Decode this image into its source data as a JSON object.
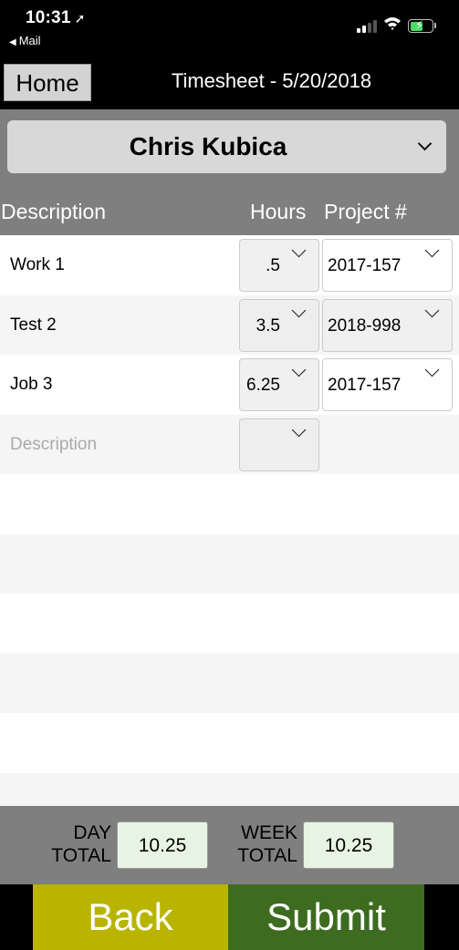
{
  "status": {
    "time": "10:31",
    "back_app": "Mail"
  },
  "nav": {
    "home_label": "Home",
    "title": "Timesheet - 5/20/2018"
  },
  "employee": {
    "name": "Chris Kubica"
  },
  "columns": {
    "description": "Description",
    "hours": "Hours",
    "project": "Project #"
  },
  "entries": [
    {
      "description": "Work 1",
      "hours": ".5",
      "project": "2017-157"
    },
    {
      "description": "Test 2",
      "hours": "3.5",
      "project": "2018-998"
    },
    {
      "description": "Job 3",
      "hours": "6.25",
      "project": "2017-157"
    }
  ],
  "new_entry": {
    "description_placeholder": "Description"
  },
  "totals": {
    "day_label_1": "DAY",
    "day_label_2": "TOTAL",
    "day_value": "10.25",
    "week_label_1": "WEEK",
    "week_label_2": "TOTAL",
    "week_value": "10.25"
  },
  "actions": {
    "back_label": "Back",
    "submit_label": "Submit"
  },
  "colors": {
    "back_button": "#b8b400",
    "submit_button": "#3d6b1f",
    "header_gray": "#7f7f7f",
    "total_box": "#e8f4e3"
  }
}
